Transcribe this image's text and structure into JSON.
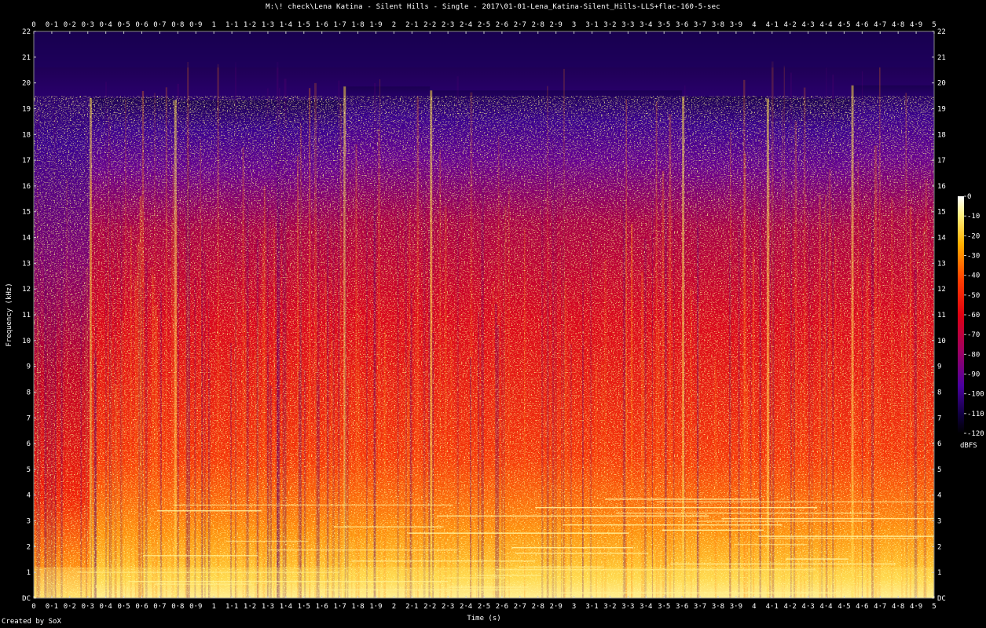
{
  "window": {
    "title": "M:\\! check\\Lena Katina - Silent Hills - Single - 2017\\01-01-Lena_Katina-Silent_Hills-LLS+flac-160-5-sec",
    "credit": "Created by SoX"
  },
  "chart_data": {
    "type": "heatmap",
    "title": "M:\\! check\\Lena Katina - Silent Hills - Single - 2017\\01-01-Lena_Katina-Silent_Hills-LLS+flac-160-5-sec",
    "xlabel": "Time (s)",
    "ylabel": "Frequency (kHz)",
    "xlim": [
      0,
      5
    ],
    "ylim": [
      0,
      22
    ],
    "x_ticks": [
      "0",
      "0·1",
      "0·2",
      "0·3",
      "0·4",
      "0·5",
      "0·6",
      "0·7",
      "0·8",
      "0·9",
      "1",
      "1·1",
      "1·2",
      "1·3",
      "1·4",
      "1·5",
      "1·6",
      "1·7",
      "1·8",
      "1·9",
      "2",
      "2·1",
      "2·2",
      "2·3",
      "2·4",
      "2·5",
      "2·6",
      "2·7",
      "2·8",
      "2·9",
      "3",
      "3·1",
      "3·2",
      "3·3",
      "3·4",
      "3·5",
      "3·6",
      "3·7",
      "3·8",
      "3·9",
      "4",
      "4·1",
      "4·2",
      "4·3",
      "4·4",
      "4·5",
      "4·6",
      "4·7",
      "4·8",
      "4·9",
      "5"
    ],
    "y_ticks": [
      "DC",
      "1",
      "2",
      "3",
      "4",
      "5",
      "6",
      "7",
      "8",
      "9",
      "10",
      "11",
      "12",
      "13",
      "14",
      "15",
      "16",
      "17",
      "18",
      "19",
      "20",
      "21",
      "22"
    ],
    "colorbar": {
      "label": "dBFS",
      "range": [
        -120,
        0
      ],
      "ticks": [
        "0",
        "-10",
        "-20",
        "-30",
        "-40",
        "-50",
        "-60",
        "-70",
        "-80",
        "-90",
        "-100",
        "-110",
        "-120"
      ]
    },
    "onsets_s": [
      0.31,
      0.78,
      1.72,
      2.2,
      3.6,
      4.07,
      4.54
    ]
  }
}
